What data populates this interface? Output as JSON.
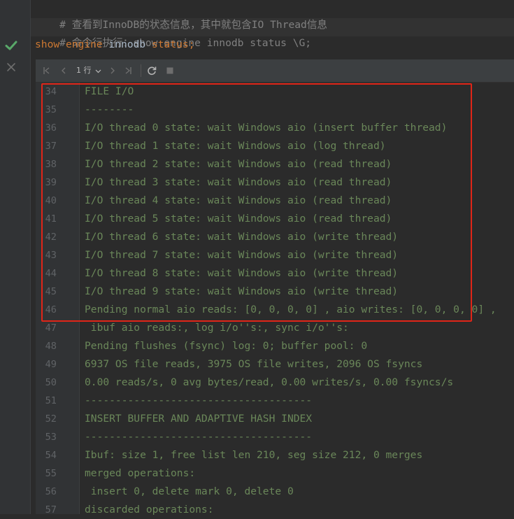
{
  "editor": {
    "line1_comment": "# 查看到InnoDB的状态信息，其中就包含IO Thread信息",
    "line2_comment": "# 命令行执行：show engine innodb status \\G;",
    "statement": {
      "kw1": "show",
      "kw2": "engine",
      "id": "innodb",
      "kw3": "status",
      "end": ";"
    }
  },
  "gutter": {
    "status_icon": "checkmark-icon",
    "close_icon": "close-icon",
    "colors": {
      "check": "#59a869",
      "close": "#6e6e6e"
    }
  },
  "toolbar": {
    "first_icon": "first-page-icon",
    "prev_icon": "prev-page-icon",
    "rows_label": "1 行",
    "next_icon": "next-page-icon",
    "last_icon": "last-page-icon",
    "refresh_icon": "refresh-icon",
    "stop_icon": "stop-icon"
  },
  "output": {
    "rows": [
      {
        "no": "34",
        "text": "FILE I/O"
      },
      {
        "no": "35",
        "text": "--------"
      },
      {
        "no": "36",
        "text": "I/O thread 0 state: wait Windows aio (insert buffer thread)"
      },
      {
        "no": "37",
        "text": "I/O thread 1 state: wait Windows aio (log thread)"
      },
      {
        "no": "38",
        "text": "I/O thread 2 state: wait Windows aio (read thread)"
      },
      {
        "no": "39",
        "text": "I/O thread 3 state: wait Windows aio (read thread)"
      },
      {
        "no": "40",
        "text": "I/O thread 4 state: wait Windows aio (read thread)"
      },
      {
        "no": "41",
        "text": "I/O thread 5 state: wait Windows aio (read thread)"
      },
      {
        "no": "42",
        "text": "I/O thread 6 state: wait Windows aio (write thread)"
      },
      {
        "no": "43",
        "text": "I/O thread 7 state: wait Windows aio (write thread)"
      },
      {
        "no": "44",
        "text": "I/O thread 8 state: wait Windows aio (write thread)"
      },
      {
        "no": "45",
        "text": "I/O thread 9 state: wait Windows aio (write thread)"
      },
      {
        "no": "46",
        "text": "Pending normal aio reads: [0, 0, 0, 0] , aio writes: [0, 0, 0, 0] ,"
      },
      {
        "no": "47",
        "text": " ibuf aio reads:, log i/o''s:, sync i/o''s:"
      },
      {
        "no": "48",
        "text": "Pending flushes (fsync) log: 0; buffer pool: 0"
      },
      {
        "no": "49",
        "text": "6937 OS file reads, 3975 OS file writes, 2096 OS fsyncs"
      },
      {
        "no": "50",
        "text": "0.00 reads/s, 0 avg bytes/read, 0.00 writes/s, 0.00 fsyncs/s"
      },
      {
        "no": "51",
        "text": "-------------------------------------"
      },
      {
        "no": "52",
        "text": "INSERT BUFFER AND ADAPTIVE HASH INDEX"
      },
      {
        "no": "53",
        "text": "-------------------------------------"
      },
      {
        "no": "54",
        "text": "Ibuf: size 1, free list len 210, seg size 212, 0 merges"
      },
      {
        "no": "55",
        "text": "merged operations:"
      },
      {
        "no": "56",
        "text": " insert 0, delete mark 0, delete 0"
      },
      {
        "no": "57",
        "text": "discarded operations:"
      }
    ],
    "colors": {
      "text": "#6a8759",
      "line_no": "#606366",
      "highlight": "#e02518"
    }
  }
}
